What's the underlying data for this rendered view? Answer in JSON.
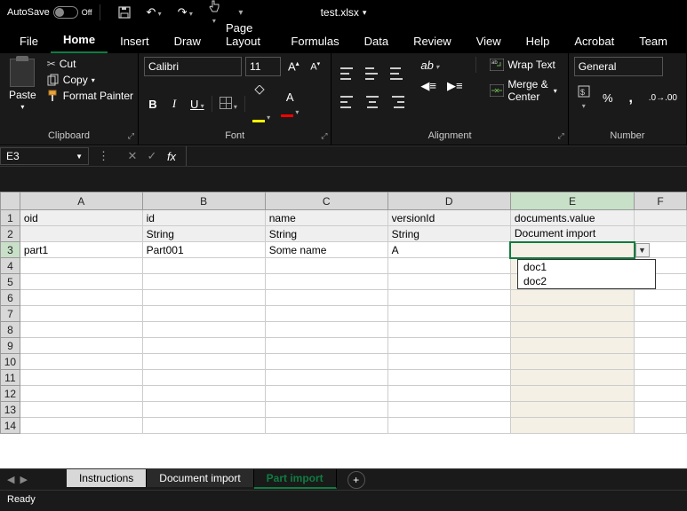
{
  "titlebar": {
    "autosave_label": "AutoSave",
    "autosave_state": "Off",
    "filename": "test.xlsx"
  },
  "tabs": {
    "file": "File",
    "home": "Home",
    "insert": "Insert",
    "draw": "Draw",
    "page_layout": "Page Layout",
    "formulas": "Formulas",
    "data": "Data",
    "review": "Review",
    "view": "View",
    "help": "Help",
    "acrobat": "Acrobat",
    "team": "Team"
  },
  "ribbon": {
    "clipboard": {
      "paste": "Paste",
      "cut": "Cut",
      "copy": "Copy",
      "format_painter": "Format Painter",
      "group_label": "Clipboard"
    },
    "font": {
      "name": "Calibri",
      "size": "11",
      "group_label": "Font"
    },
    "alignment": {
      "wrap": "Wrap Text",
      "merge": "Merge & Center",
      "group_label": "Alignment"
    },
    "number": {
      "format": "General",
      "group_label": "Number"
    }
  },
  "formula_bar": {
    "name_box": "E3",
    "formula": ""
  },
  "grid": {
    "columns": [
      "A",
      "B",
      "C",
      "D",
      "E",
      "F"
    ],
    "active_col": "E",
    "active_row": 3,
    "rows": [
      {
        "r": 1,
        "hdr": true,
        "cells": [
          "oid",
          "id",
          "name",
          "versionId",
          "documents.value",
          ""
        ]
      },
      {
        "r": 2,
        "hdr": true,
        "cells": [
          "",
          "String",
          "String",
          "String",
          "Document import",
          ""
        ]
      },
      {
        "r": 3,
        "cells": [
          "part1",
          "Part001",
          "Some name",
          "A",
          "",
          ""
        ]
      },
      {
        "r": 4,
        "cells": [
          "",
          "",
          "",
          "",
          "",
          ""
        ]
      },
      {
        "r": 5,
        "cells": [
          "",
          "",
          "",
          "",
          "",
          ""
        ]
      },
      {
        "r": 6,
        "cells": [
          "",
          "",
          "",
          "",
          "",
          ""
        ]
      },
      {
        "r": 7,
        "cells": [
          "",
          "",
          "",
          "",
          "",
          ""
        ]
      },
      {
        "r": 8,
        "cells": [
          "",
          "",
          "",
          "",
          "",
          ""
        ]
      },
      {
        "r": 9,
        "cells": [
          "",
          "",
          "",
          "",
          "",
          ""
        ]
      },
      {
        "r": 10,
        "cells": [
          "",
          "",
          "",
          "",
          "",
          ""
        ]
      },
      {
        "r": 11,
        "cells": [
          "",
          "",
          "",
          "",
          "",
          ""
        ]
      },
      {
        "r": 12,
        "cells": [
          "",
          "",
          "",
          "",
          "",
          ""
        ]
      },
      {
        "r": 13,
        "cells": [
          "",
          "",
          "",
          "",
          "",
          ""
        ]
      },
      {
        "r": 14,
        "cells": [
          "",
          "",
          "",
          "",
          "",
          ""
        ]
      }
    ],
    "dropdown": {
      "options": [
        "doc1",
        "doc2"
      ]
    }
  },
  "sheets": {
    "tabs": [
      "Instructions",
      "Document import",
      "Part import"
    ],
    "active": "Part import"
  },
  "status": {
    "ready": "Ready"
  }
}
